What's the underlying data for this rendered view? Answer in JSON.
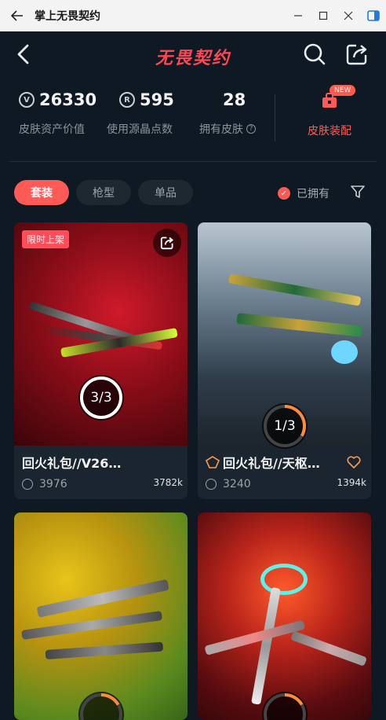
{
  "window": {
    "title": "掌上无畏契约"
  },
  "header": {
    "logo_text": "无畏契约"
  },
  "stats": {
    "asset_value": {
      "value": "26330",
      "label": "皮肤资产价值"
    },
    "points": {
      "value": "595",
      "label": "使用源晶点数"
    },
    "owned": {
      "value": "28",
      "label": "拥有皮肤"
    },
    "loadout": {
      "label": "皮肤装配",
      "badge": "NEW"
    }
  },
  "tabs": [
    {
      "label": "套装",
      "active": true
    },
    {
      "label": "枪型",
      "active": false
    },
    {
      "label": "单品",
      "active": false
    }
  ],
  "owned_filter": {
    "label": "已拥有",
    "checked": true
  },
  "cards": [
    {
      "name": "回火礼包//V26…",
      "price": "3976",
      "views": "3782k",
      "badge": "限时上架",
      "progress": "3/3",
      "progress_fraction": 1.0
    },
    {
      "name": "回火礼包//天枢…",
      "price": "3240",
      "views": "1394k",
      "progress": "1/3",
      "progress_fraction": 0.333
    },
    {
      "name": "",
      "price": "",
      "views": ""
    },
    {
      "name": "",
      "price": "",
      "views": ""
    }
  ],
  "colors": {
    "accent": "#ff5a55",
    "background": "#0f1923",
    "card": "#1b2530"
  }
}
